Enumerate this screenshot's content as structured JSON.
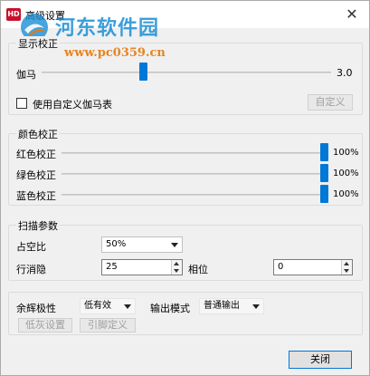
{
  "window": {
    "title": "高级设置",
    "app_icon_text": "HD"
  },
  "watermark": {
    "name": "河东软件园",
    "url": "www.pc0359.cn"
  },
  "display": {
    "group_title": "显示校正",
    "gamma_label": "伽马",
    "gamma_value": "3.0",
    "gamma_level": 0.35,
    "custom_gamma_checkbox_label": "使用自定义伽马表",
    "custom_gamma_checked": false,
    "custom_button": "自定义"
  },
  "color": {
    "group_title": "颜色校正",
    "rows": [
      {
        "label": "红色校正",
        "value": "100%",
        "level": 1.0
      },
      {
        "label": "绿色校正",
        "value": "100%",
        "level": 1.0
      },
      {
        "label": "蓝色校正",
        "value": "100%",
        "level": 1.0
      }
    ]
  },
  "scan": {
    "group_title": "扫描参数",
    "duty_label": "占空比",
    "duty_value": "50%",
    "blank_label": "行消隐",
    "blank_value": "25",
    "phase_label": "相位",
    "phase_value": "0"
  },
  "misc": {
    "afterglow_label": "余辉极性",
    "afterglow_value": "低有效",
    "output_label": "输出模式",
    "output_value": "普通输出",
    "lowgray_button": "低灰设置",
    "pin_button": "引脚定义"
  },
  "footer": {
    "close_button": "关闭"
  },
  "colors": {
    "accent": "#0078d7",
    "watermark_blue": "#1a8fd6",
    "watermark_orange": "#e8780a"
  }
}
